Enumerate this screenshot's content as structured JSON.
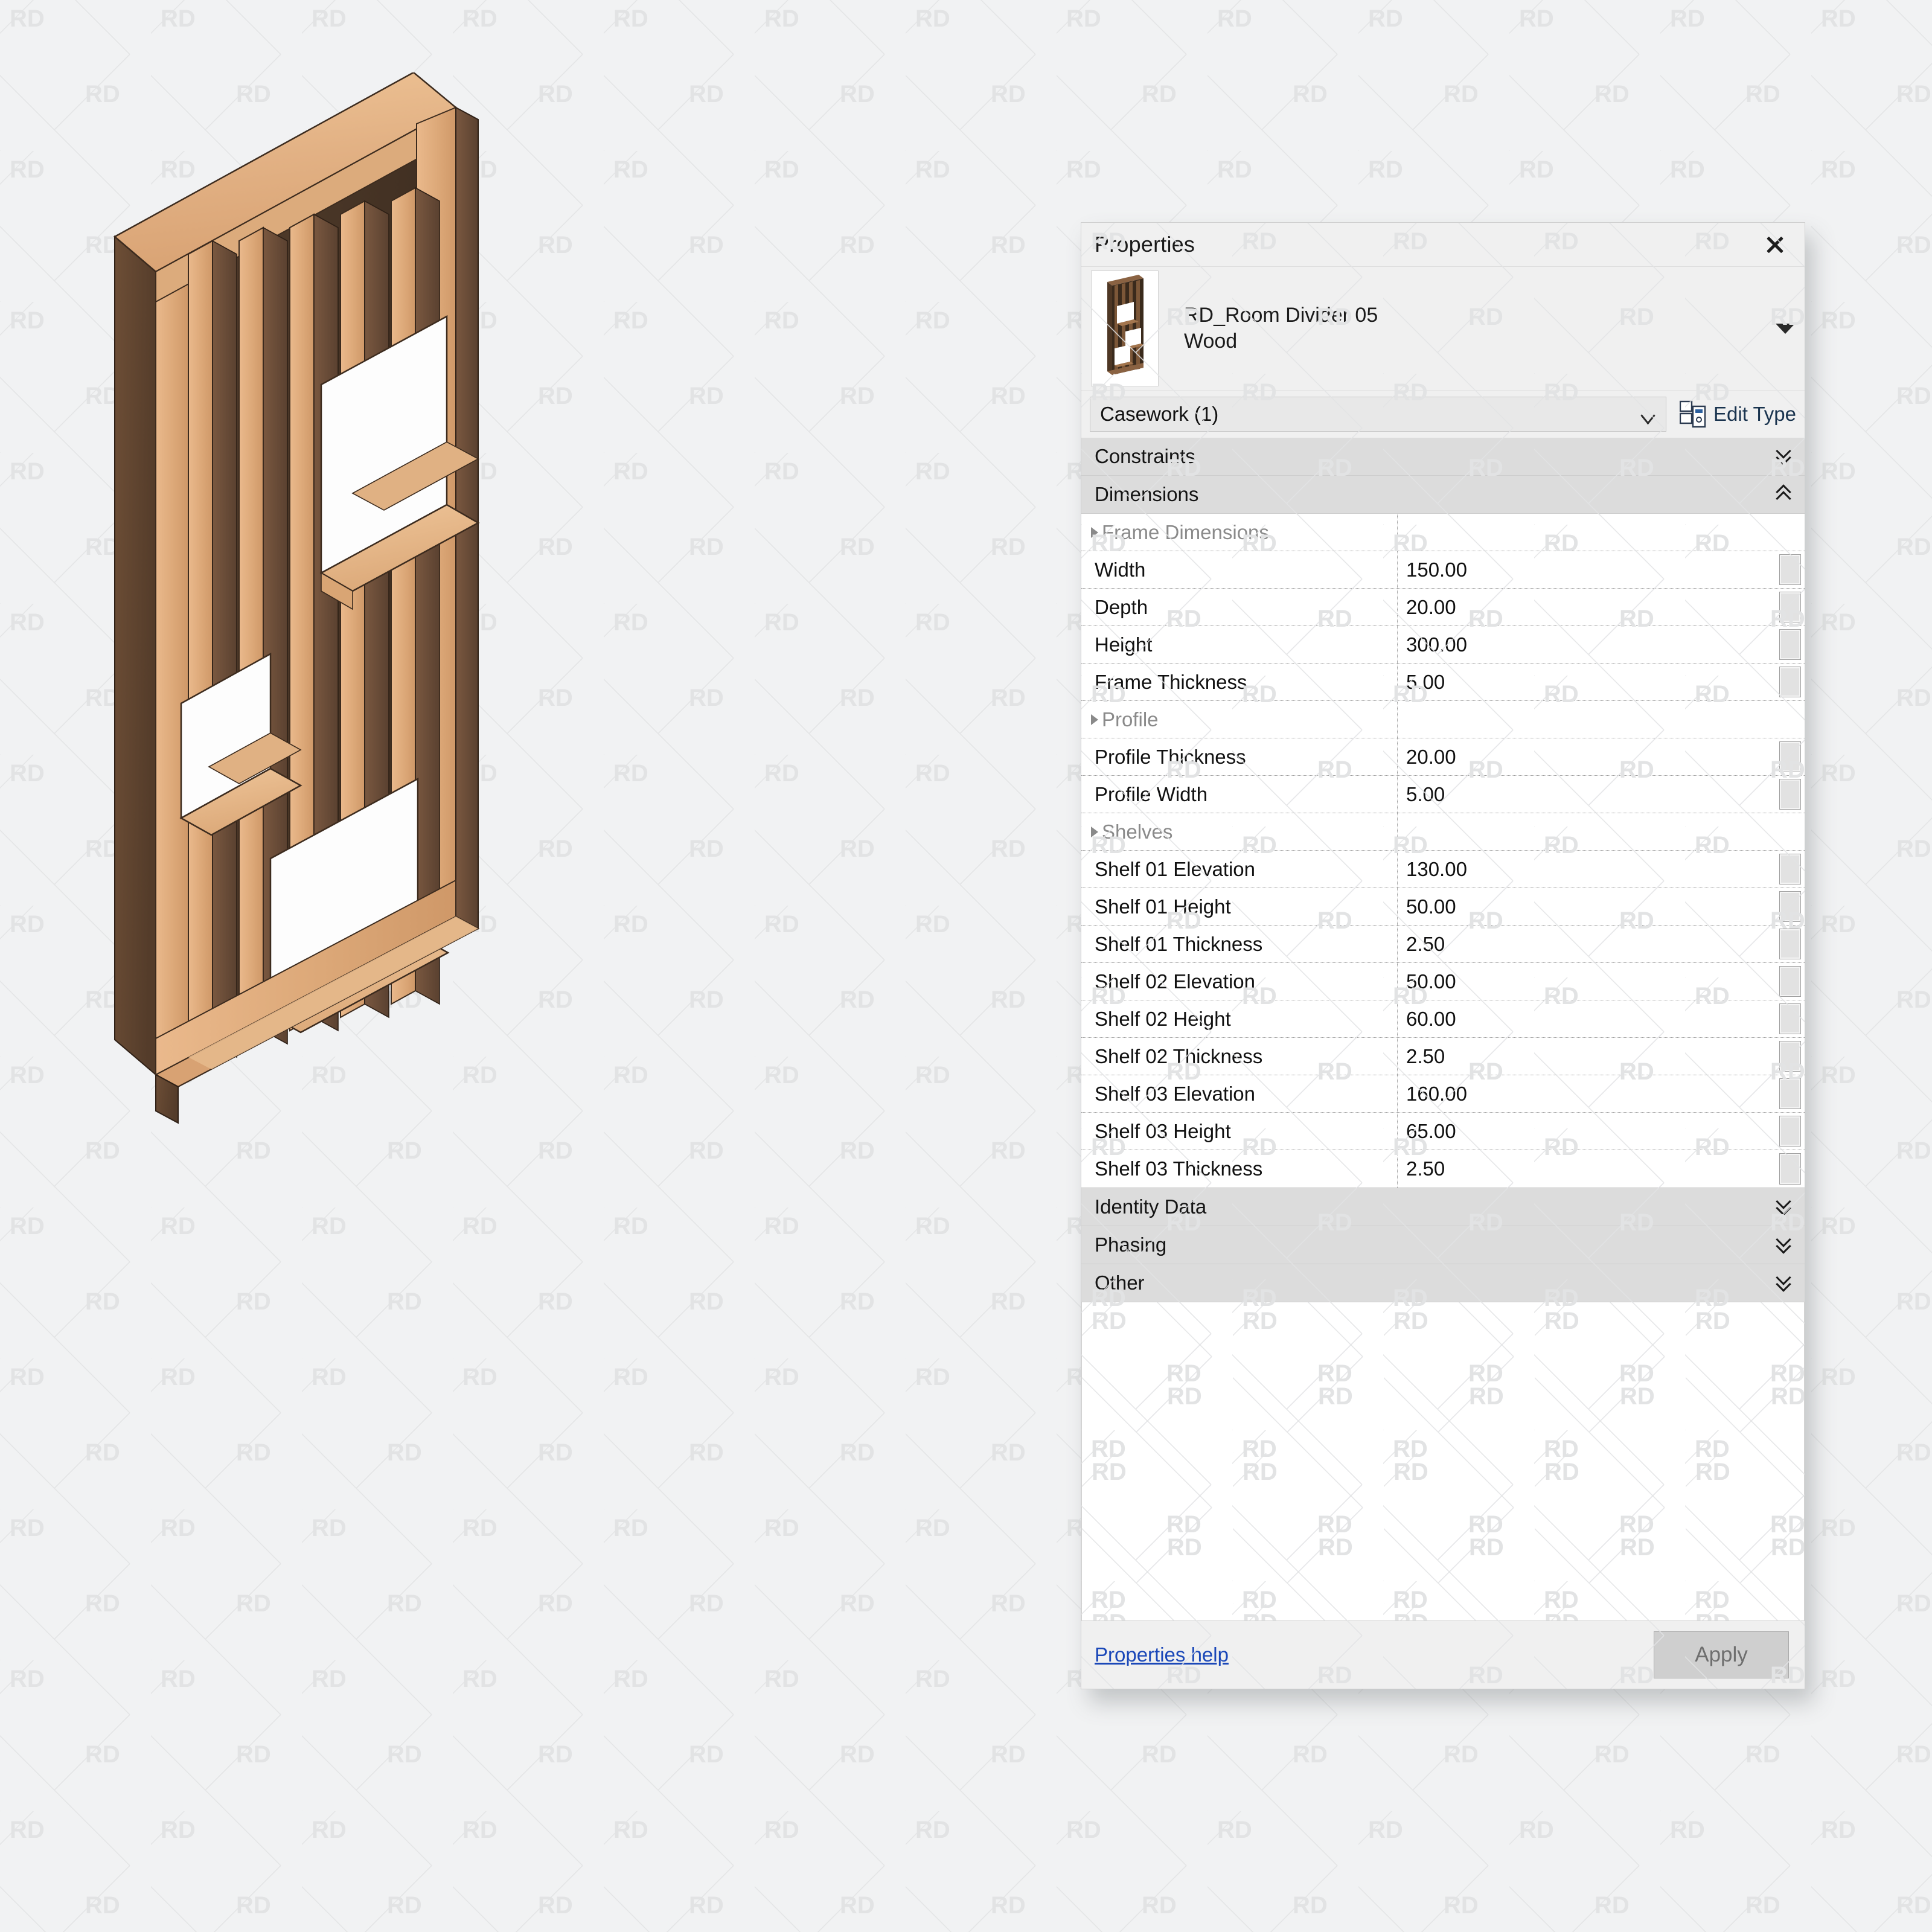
{
  "background": {
    "watermark_text": "RD",
    "bg_color": "#f1f2f3",
    "watermark_color": "#e2e3e4"
  },
  "model": {
    "name": "RD_Room Divider 05 Wood",
    "description": "Isometric 3D render of a vertical-slat wooden room divider with three open shelf niches",
    "wood_light": "#e8b98b",
    "wood_mid": "#c98f5e",
    "wood_dark": "#5e4430",
    "wood_shadow": "#4a3426"
  },
  "panel": {
    "title": "Properties",
    "close_icon": "close-icon",
    "type_caret_icon": "chevron-down-icon",
    "preview": {
      "alt": "RD_Room Divider 05 Wood preview thumbnail"
    },
    "family_name": "RD_Room Divider 05",
    "type_name": "Wood",
    "category_selector": {
      "value": "Casework (1)",
      "caret_icon": "chevron-down-icon"
    },
    "edit_type": {
      "label": "Edit Type",
      "icon": "edit-type-icon"
    },
    "groups": [
      {
        "label": "Constraints",
        "state": "collapsed",
        "icon": "double-chevron-down-icon"
      },
      {
        "label": "Dimensions",
        "state": "expanded",
        "icon": "double-chevron-up-icon"
      }
    ],
    "rows": [
      {
        "name": "Frame Dimensions",
        "value": "",
        "type": "subgroup"
      },
      {
        "name": "Width",
        "value": "150.00",
        "type": "value"
      },
      {
        "name": "Depth",
        "value": "20.00",
        "type": "value"
      },
      {
        "name": "Height",
        "value": "300.00",
        "type": "value"
      },
      {
        "name": "Frame Thickness",
        "value": "5.00",
        "type": "value"
      },
      {
        "name": "Profile",
        "value": "",
        "type": "subgroup"
      },
      {
        "name": "Profile Thickness",
        "value": "20.00",
        "type": "value"
      },
      {
        "name": "Profile Width",
        "value": "5.00",
        "type": "value"
      },
      {
        "name": "Shelves",
        "value": "",
        "type": "subgroup"
      },
      {
        "name": "Shelf 01 Elevation",
        "value": "130.00",
        "type": "value"
      },
      {
        "name": "Shelf 01 Height",
        "value": "50.00",
        "type": "value"
      },
      {
        "name": "Shelf 01 Thickness",
        "value": "2.50",
        "type": "value"
      },
      {
        "name": "Shelf 02 Elevation",
        "value": "50.00",
        "type": "value"
      },
      {
        "name": "Shelf 02 Height",
        "value": "60.00",
        "type": "value"
      },
      {
        "name": "Shelf 02 Thickness",
        "value": "2.50",
        "type": "value"
      },
      {
        "name": "Shelf 03 Elevation",
        "value": "160.00",
        "type": "value"
      },
      {
        "name": "Shelf 03 Height",
        "value": "65.00",
        "type": "value"
      },
      {
        "name": "Shelf 03 Thickness",
        "value": "2.50",
        "type": "value"
      }
    ],
    "bottom_groups": [
      {
        "label": "Identity Data",
        "state": "collapsed",
        "icon": "double-chevron-down-icon"
      },
      {
        "label": "Phasing",
        "state": "collapsed",
        "icon": "double-chevron-down-icon"
      },
      {
        "label": "Other",
        "state": "collapsed",
        "icon": "double-chevron-down-icon"
      }
    ],
    "footer": {
      "help_label": "Properties help",
      "apply_label": "Apply"
    }
  },
  "colors": {
    "panel_bg": "#f0f0f0",
    "group_bar": "#dcdcdc",
    "table_bg": "#ffffff",
    "link_blue": "#1a47b8",
    "edit_type_blue": "#19334e",
    "apply_disabled_text": "#6f6f6f"
  }
}
